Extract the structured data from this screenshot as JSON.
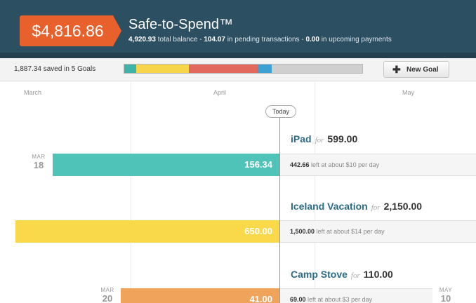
{
  "header": {
    "safe_amount": "$4,816.86",
    "title": "Safe-to-Spend™",
    "total_balance": "4,920.93",
    "total_balance_label": "total balance -",
    "pending": "104.07",
    "pending_label": "in pending transactions -",
    "upcoming": "0.00",
    "upcoming_label": "in upcoming payments"
  },
  "summary": {
    "text": "1,887.34 saved in 5 Goals",
    "new_goal_label": "New Goal",
    "progress_segments": [
      {
        "name": "goal-1",
        "color": "#3fb3a8",
        "fraction": 0.05
      },
      {
        "name": "goal-2",
        "color": "#f7d54a",
        "fraction": 0.22
      },
      {
        "name": "goal-3",
        "color": "#e2675c",
        "fraction": 0.29
      },
      {
        "name": "goal-4",
        "color": "#3ea1d4",
        "fraction": 0.06
      },
      {
        "name": "remaining",
        "color": "#cfcfcf",
        "fraction": 0.38
      }
    ]
  },
  "timeline": {
    "months": [
      "March",
      "April",
      "May"
    ],
    "today_label": "Today"
  },
  "goals": [
    {
      "name": "iPad",
      "for": "for",
      "amount": "599.00",
      "saved": "156.34",
      "left": "442.66",
      "left_text": "left at about $10 per day",
      "color": "#4fc3b7",
      "start_month": "MAR",
      "start_day": "18"
    },
    {
      "name": "Iceland Vacation",
      "for": "for",
      "amount": "2,150.00",
      "saved": "650.00",
      "left": "1,500.00",
      "left_text": "left at about $14 per day",
      "color": "#f9d849"
    },
    {
      "name": "Camp Stove",
      "for": "for",
      "amount": "110.00",
      "saved": "41.00",
      "left": "69.00",
      "left_text": "left at about $3 per day",
      "color": "#f0a35a",
      "start_month": "MAR",
      "start_day": "20",
      "end_month": "MAY",
      "end_day": "10"
    }
  ]
}
